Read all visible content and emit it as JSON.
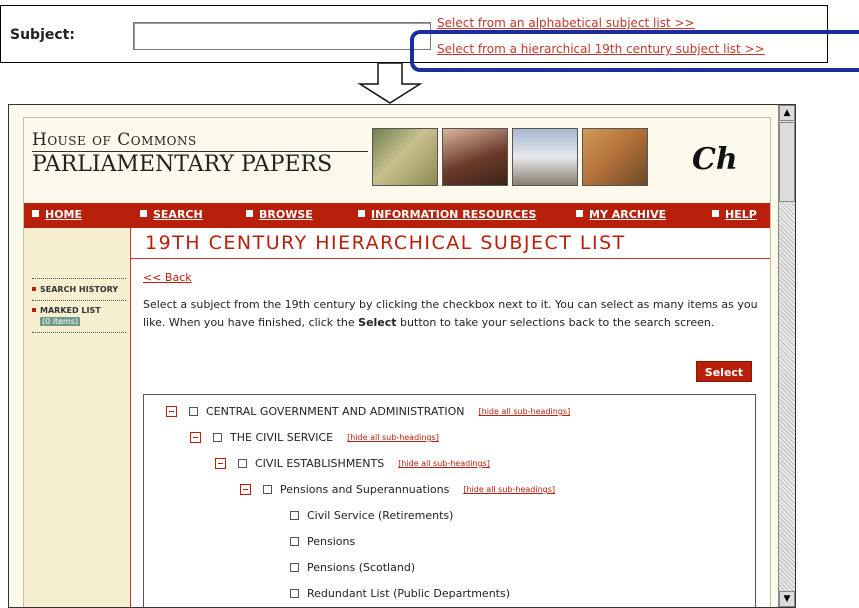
{
  "subject_strip": {
    "label": "Subject:",
    "input_value": "",
    "alpha_link": "Select from an alphabetical subject list >>",
    "hier_link": "Select from a hierarchical 19th century subject list >>"
  },
  "site": {
    "logo_line1": "House of Commons",
    "logo_line2": "PARLIAMENTARY PAPERS",
    "logo_mark": "Ch"
  },
  "nav": {
    "items": [
      "HOME",
      "SEARCH",
      "BROWSE",
      "INFORMATION RESOURCES",
      "MY ARCHIVE",
      "HELP"
    ]
  },
  "sidebar": {
    "search_history": "SEARCH HISTORY",
    "marked_list": "MARKED LIST",
    "marked_count": "(0 items)"
  },
  "main": {
    "title": "19TH CENTURY HIERARCHICAL SUBJECT LIST",
    "back": "<< Back",
    "instructions_1": "Select a subject from the 19th century by clicking the checkbox next to it. You can select as many items as you like. When you have finished, click the ",
    "instructions_bold": "Select",
    "instructions_2": " button to take your selections back to the search screen.",
    "select_button": "Select"
  },
  "tree": {
    "hide_label": "[hide all sub-headings]",
    "nodes": [
      {
        "label": "CENTRAL GOVERNMENT AND ADMINISTRATION",
        "expandable": true
      },
      {
        "label": "THE CIVIL SERVICE",
        "expandable": true
      },
      {
        "label": "CIVIL ESTABLISHMENTS",
        "expandable": true
      },
      {
        "label": "Pensions and Superannuations",
        "expandable": true
      },
      {
        "label": "Civil Service (Retirements)",
        "expandable": false
      },
      {
        "label": "Pensions",
        "expandable": false
      },
      {
        "label": "Pensions (Scotland)",
        "expandable": false
      },
      {
        "label": "Redundant List (Public Departments)",
        "expandable": false
      }
    ]
  },
  "colors": {
    "accent_red": "#b8200c",
    "highlight_blue": "#1b2d9f",
    "page_bg": "#fdf9ec"
  }
}
